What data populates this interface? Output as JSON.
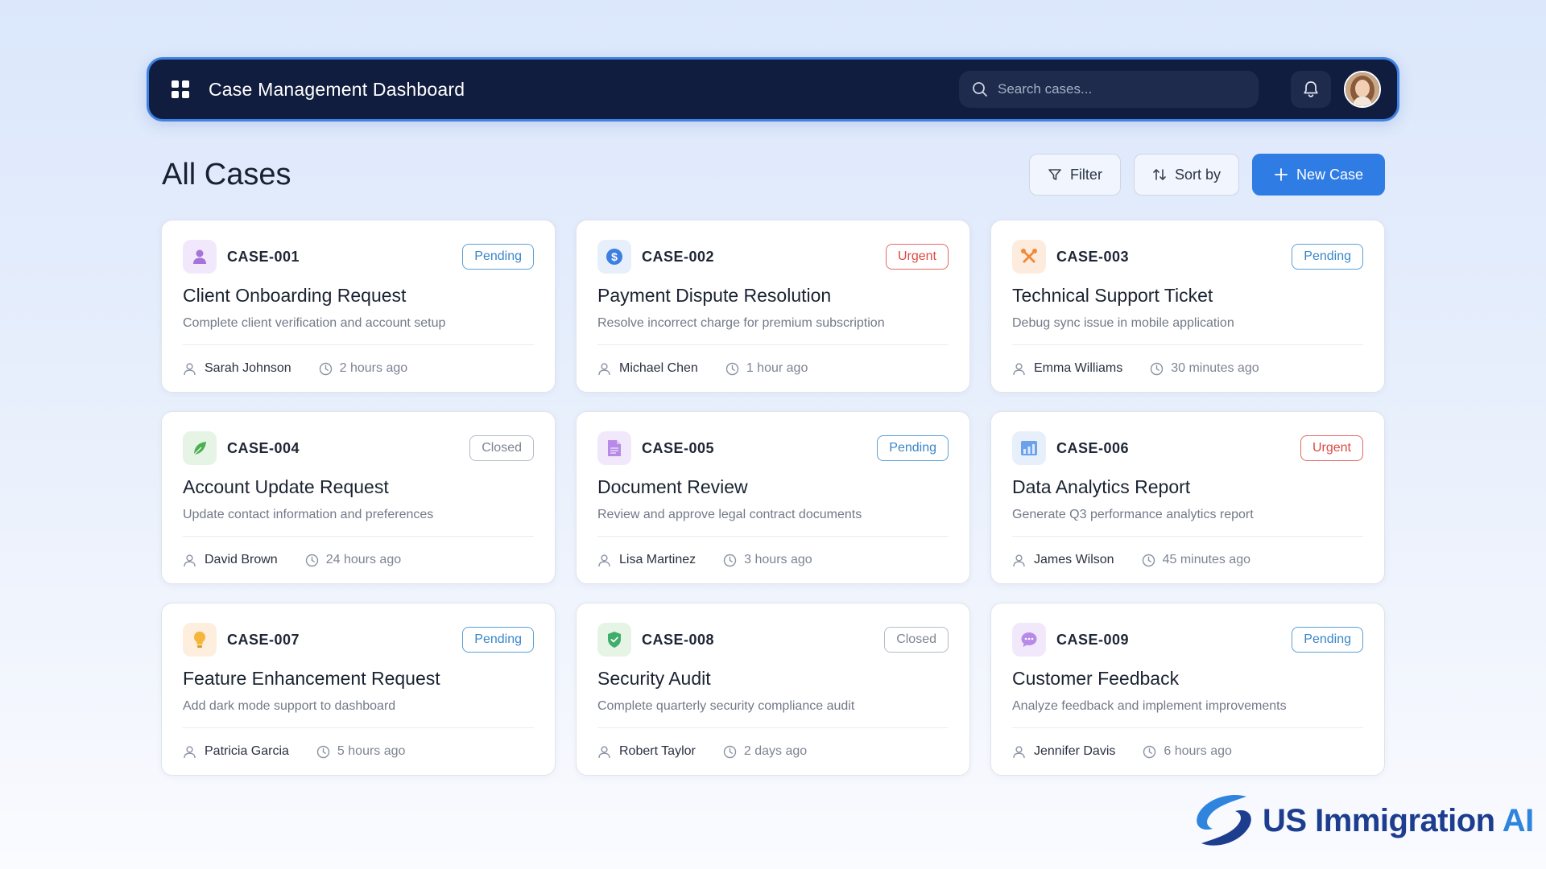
{
  "header": {
    "title": "Case Management Dashboard",
    "search_placeholder": "Search cases...",
    "grid_icon": "grid-icon",
    "bell_icon": "bell-icon"
  },
  "page": {
    "title": "All Cases",
    "filter_label": "Filter",
    "sort_label": "Sort by",
    "new_case_label": "New Case"
  },
  "colors": {
    "header_bg": "#111d3f",
    "header_border": "#3f82e6",
    "primary": "#2f7de4",
    "pending": "#3a86c8",
    "urgent": "#dc4a42",
    "closed": "#7d8593"
  },
  "cases": [
    {
      "id": "CASE-001",
      "status": "Pending",
      "title": "Client Onboarding Request",
      "desc": "Complete client verification and account setup",
      "person": "Sarah Johnson",
      "time": "2 hours ago",
      "icon": "user-icon"
    },
    {
      "id": "CASE-002",
      "status": "Urgent",
      "title": "Payment Dispute Resolution",
      "desc": "Resolve incorrect charge for premium subscription",
      "person": "Michael Chen",
      "time": "1 hour ago",
      "icon": "dollar-icon"
    },
    {
      "id": "CASE-003",
      "status": "Pending",
      "title": "Technical Support Ticket",
      "desc": "Debug sync issue in mobile application",
      "person": "Emma Williams",
      "time": "30 minutes ago",
      "icon": "tools-icon"
    },
    {
      "id": "CASE-004",
      "status": "Closed",
      "title": "Account Update Request",
      "desc": "Update contact information and preferences",
      "person": "David Brown",
      "time": "24 hours ago",
      "icon": "leaf-icon"
    },
    {
      "id": "CASE-005",
      "status": "Pending",
      "title": "Document Review",
      "desc": "Review and approve legal contract documents",
      "person": "Lisa Martinez",
      "time": "3 hours ago",
      "icon": "document-icon"
    },
    {
      "id": "CASE-006",
      "status": "Urgent",
      "title": "Data Analytics Report",
      "desc": "Generate Q3 performance analytics report",
      "person": "James Wilson",
      "time": "45 minutes ago",
      "icon": "chart-icon"
    },
    {
      "id": "CASE-007",
      "status": "Pending",
      "title": "Feature Enhancement Request",
      "desc": "Add dark mode support to dashboard",
      "person": "Patricia Garcia",
      "time": "5 hours ago",
      "icon": "lightbulb-icon"
    },
    {
      "id": "CASE-008",
      "status": "Closed",
      "title": "Security Audit",
      "desc": "Complete quarterly security compliance audit",
      "person": "Robert Taylor",
      "time": "2 days ago",
      "icon": "shield-icon"
    },
    {
      "id": "CASE-009",
      "status": "Pending",
      "title": "Customer Feedback",
      "desc": "Analyze feedback and implement improvements",
      "person": "Jennifer Davis",
      "time": "6 hours ago",
      "icon": "chat-icon"
    }
  ],
  "logo": {
    "text_main": "US Immigration ",
    "text_accent": "AI"
  }
}
